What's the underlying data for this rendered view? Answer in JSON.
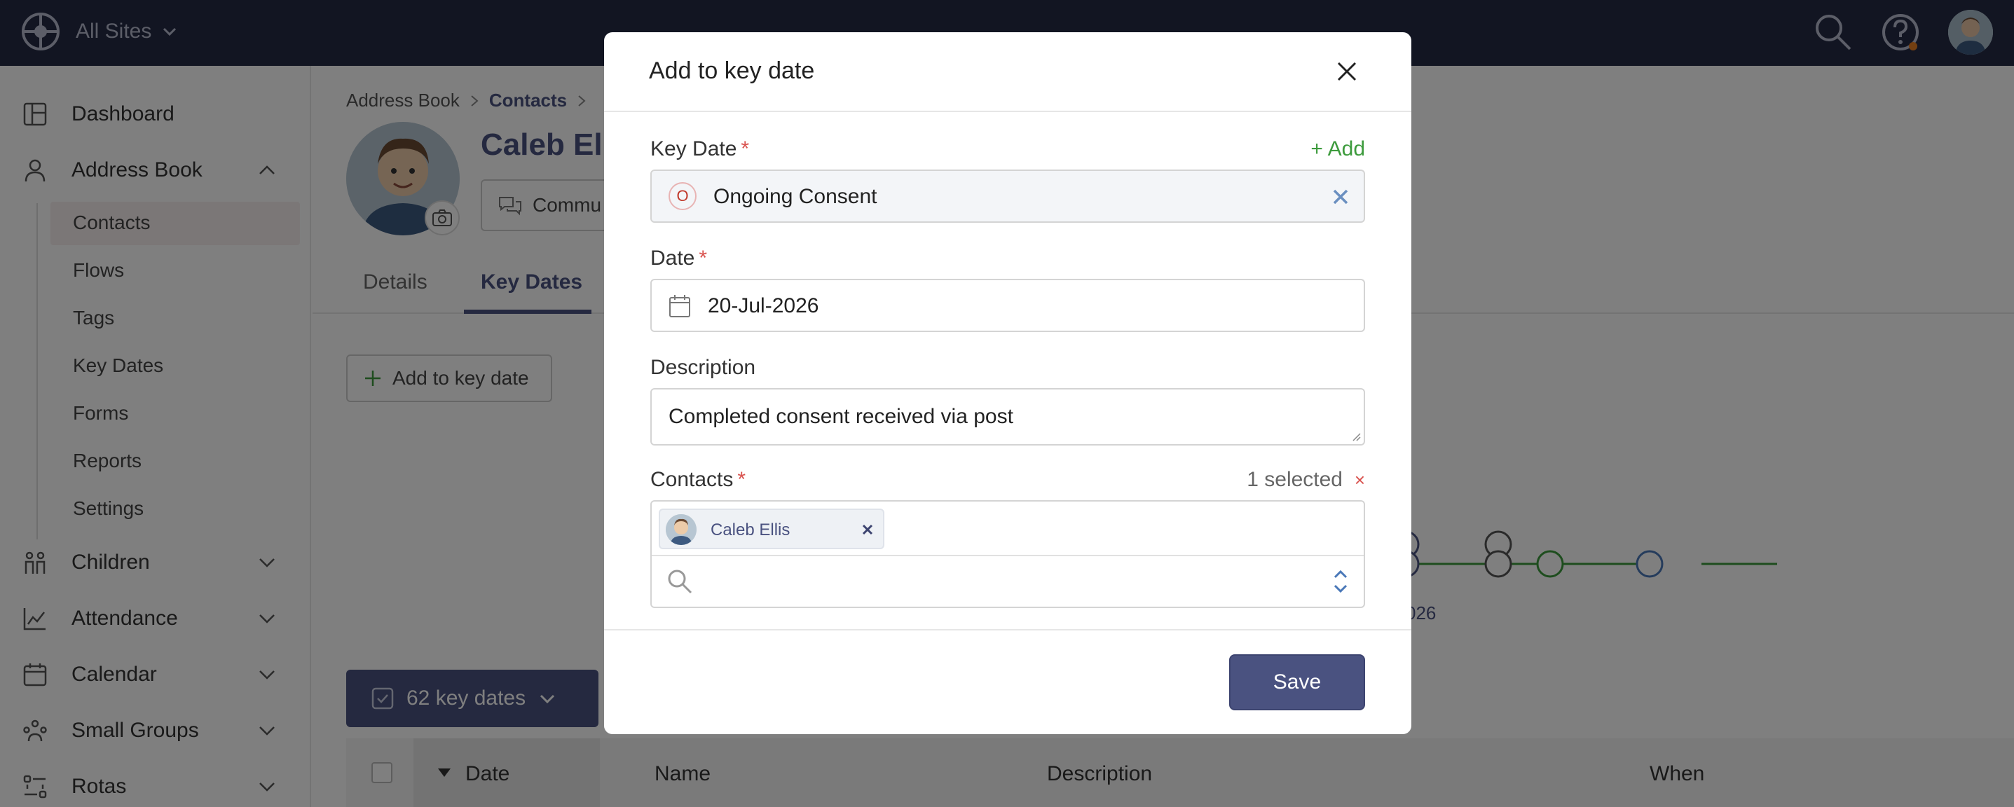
{
  "topbar": {
    "site_switch": "All Sites",
    "icons": [
      "globe-logo-icon",
      "search-icon",
      "help-icon",
      "user-avatar"
    ],
    "background": "#252a45"
  },
  "sidebar": {
    "items": [
      {
        "label": "Dashboard",
        "icon": "dashboard-icon"
      },
      {
        "label": "Address Book",
        "icon": "person-icon",
        "expanded": true
      },
      {
        "label": "Children",
        "icon": "children-icon"
      },
      {
        "label": "Attendance",
        "icon": "chart-icon"
      },
      {
        "label": "Calendar",
        "icon": "calendar-icon"
      },
      {
        "label": "Small Groups",
        "icon": "group-icon"
      },
      {
        "label": "Rotas",
        "icon": "rota-icon"
      }
    ],
    "sub_items": [
      "Contacts",
      "Flows",
      "Tags",
      "Key Dates",
      "Forms",
      "Reports",
      "Settings"
    ],
    "active_sub": "Contacts"
  },
  "main": {
    "breadcrumb": [
      "Address Book",
      "Contacts"
    ],
    "profile_name": "Caleb Elli",
    "communicate_label": "Commu",
    "tabs": [
      "Details",
      "Key Dates"
    ],
    "active_tab": "Key Dates",
    "add_button": "Add to key date",
    "key_dates_button": "62 key dates",
    "timeline_label": "026",
    "table_headers": [
      "Date",
      "Name",
      "Description",
      "When"
    ]
  },
  "modal": {
    "title": "Add to key date",
    "key_date": {
      "label": "Key Date",
      "add_link": "+ Add",
      "initial": "O",
      "value": "Ongoing Consent"
    },
    "date": {
      "label": "Date",
      "value": "20-Jul-2026"
    },
    "description": {
      "label": "Description",
      "value": "Completed consent received via post"
    },
    "contacts": {
      "label": "Contacts",
      "count": "1 selected",
      "clear": "×",
      "chips": [
        "Caleb Ellis"
      ],
      "search_placeholder": ""
    },
    "save_label": "Save"
  },
  "colors": {
    "primary": "#4a5280",
    "required": "#d9534f",
    "add_link": "#3d9b3d"
  }
}
